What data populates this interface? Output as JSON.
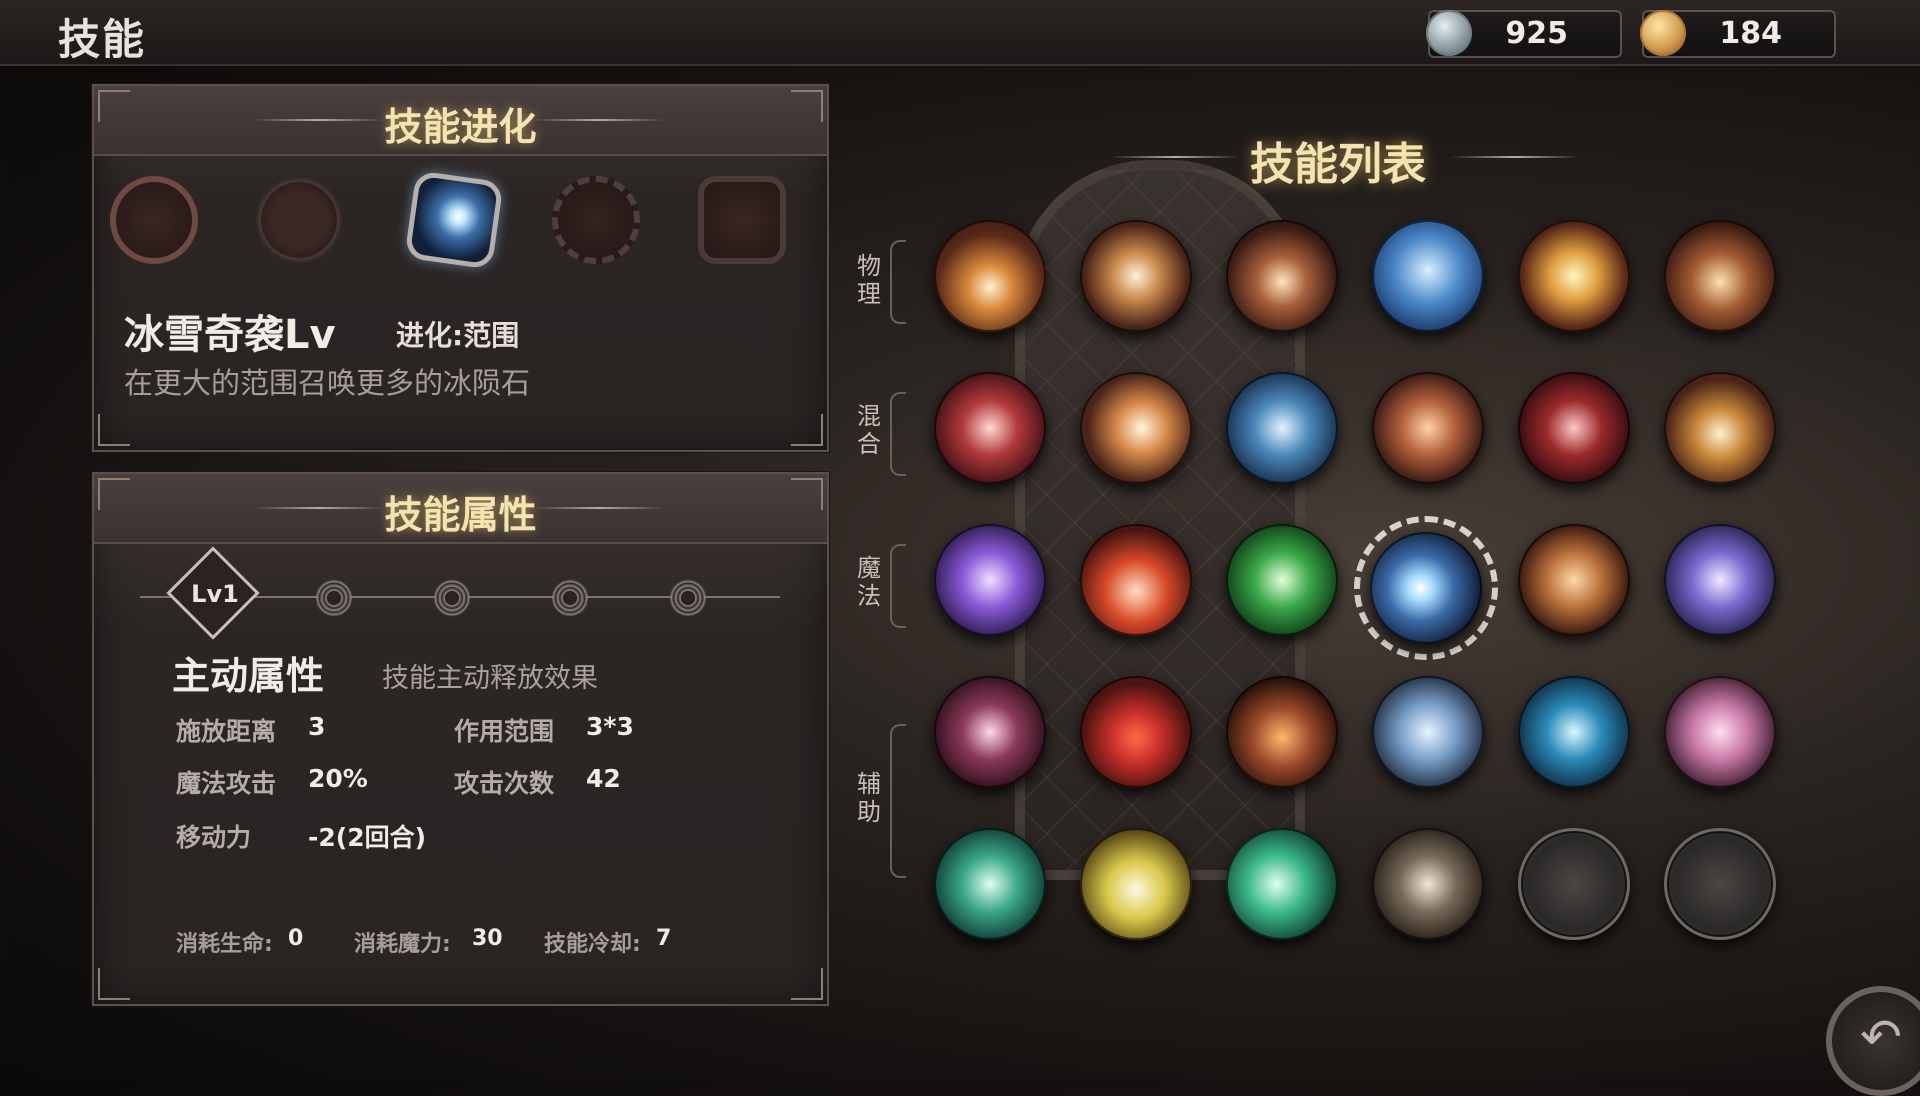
{
  "header": {
    "title": "技能",
    "currencies": [
      {
        "name": "silver-coin-icon",
        "value": "925"
      },
      {
        "name": "gold-coin-icon",
        "value": "184"
      }
    ]
  },
  "evolution_panel": {
    "title": "技能进化",
    "skill_name": "冰雪奇袭Lv",
    "evolution_label": "进化:范围",
    "description": "在更大的范围召唤更多的冰陨石"
  },
  "attribute_panel": {
    "title": "技能属性",
    "level_label": "Lv1",
    "section_title": "主动属性",
    "section_subtitle": "技能主动释放效果",
    "stats": [
      {
        "label": "施放距离",
        "value": "3"
      },
      {
        "label": "作用范围",
        "value": "3*3"
      },
      {
        "label": "魔法攻击",
        "value": "20%"
      },
      {
        "label": "攻击次数",
        "value": "42"
      },
      {
        "label": "移动力",
        "value": "-2(2回合)"
      }
    ],
    "costs": [
      {
        "label": "消耗生命:",
        "value": "0"
      },
      {
        "label": "消耗魔力:",
        "value": "30"
      },
      {
        "label": "技能冷却:",
        "value": "7"
      }
    ]
  },
  "skill_list": {
    "title": "技能列表",
    "categories": [
      "物理",
      "混合",
      "魔法",
      "辅助"
    ],
    "selected": "row3-col4",
    "colors": {
      "physical": "#c88a4a",
      "mixed": "#9a2a2a",
      "magic": "#6a4ab0",
      "support": "#3a9a8a"
    }
  }
}
